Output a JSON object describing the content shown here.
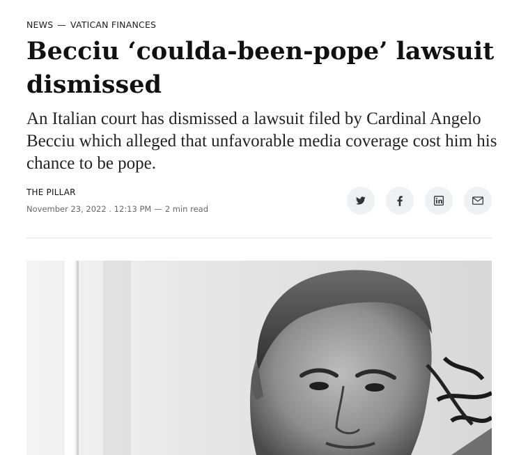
{
  "article": {
    "section": "NEWS",
    "section_separator": "—",
    "topic": "VATICAN FINANCES",
    "headline": "Becciu ‘coulda-been-pope’ lawsuit dismissed",
    "dek": "An Italian court has dismissed a lawsuit filed by Cardinal Angelo Becciu which alleged that unfavorable media coverage cost him his chance to be pope.",
    "author": "THE PILLAR",
    "date": "November 23, 2022 . 12:13 PM",
    "meta_separator": "—",
    "read_time": "2 min read"
  },
  "share": [
    {
      "icon": "twitter-icon"
    },
    {
      "icon": "facebook-icon"
    },
    {
      "icon": "linkedin-icon"
    },
    {
      "icon": "email-icon"
    }
  ],
  "colors": {
    "share_bg": "#eef1f4",
    "share_icon": "#333333",
    "divider": "#e0e0e0",
    "meta_text": "#666666"
  }
}
